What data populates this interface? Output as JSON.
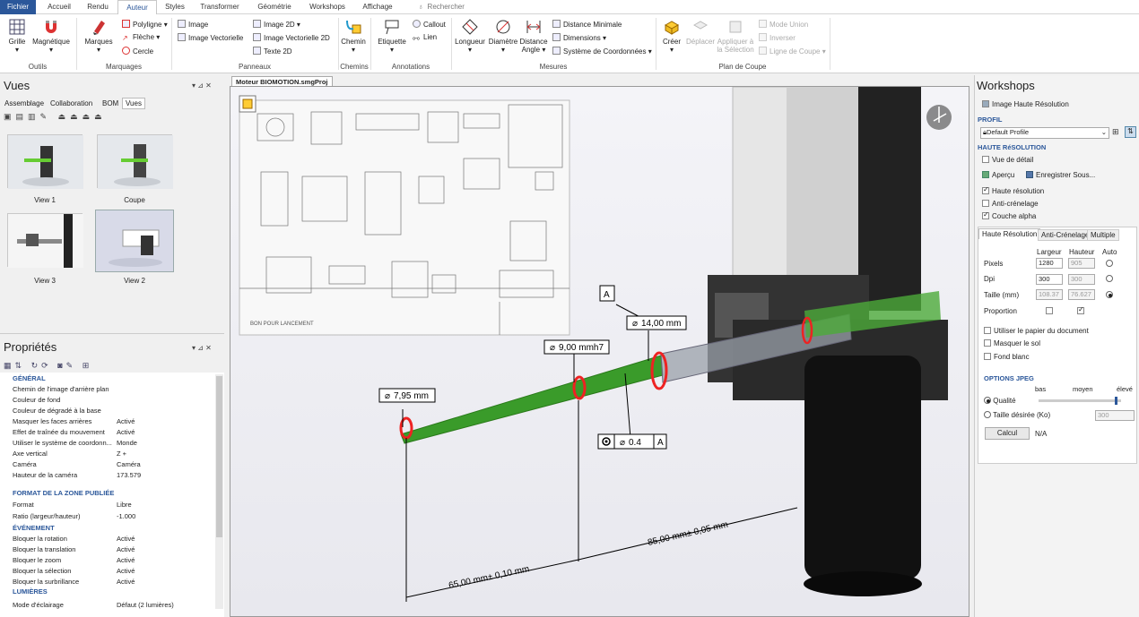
{
  "menu": {
    "file": "Fichier",
    "tabs": [
      "Accueil",
      "Rendu",
      "Auteur",
      "Styles",
      "Transformer",
      "Géométrie",
      "Workshops",
      "Affichage"
    ],
    "search": "Rechercher"
  },
  "ribbon": {
    "outils": {
      "label": "Outils",
      "grille": "Grille",
      "magnetique": "Magnétique"
    },
    "marquages": {
      "label": "Marquages",
      "marques": "Marques",
      "polyligne": "Polyligne",
      "fleche": "Flèche",
      "cercle": "Cercle"
    },
    "panneaux": {
      "label": "Panneaux",
      "image": "Image",
      "image_vect": "Image Vectorielle",
      "image2d": "Image 2D",
      "image_vect2d": "Image Vectorielle 2D",
      "texte2d": "Texte 2D"
    },
    "chemins": {
      "label": "Chemins",
      "chemin": "Chemin"
    },
    "annotations": {
      "label": "Annotations",
      "etiquette": "Etiquette",
      "callout": "Callout",
      "lien": "Lien"
    },
    "mesures": {
      "label": "Mesures",
      "longueur": "Longueur",
      "diametre": "Diamètre",
      "distance": "Distance",
      "angle": "Angle",
      "distance_min": "Distance Minimale",
      "dimensions": "Dimensions",
      "systeme": "Système de Coordonnées"
    },
    "coupe": {
      "label": "Plan de Coupe",
      "creer": "Créer",
      "deplacer": "Déplacer",
      "appliquer": "Appliquer à la Sélection",
      "mode_union": "Mode Union",
      "inverser": "Inverser",
      "ligne": "Ligne de Coupe"
    }
  },
  "vues": {
    "title": "Vues",
    "tabs": [
      "Assemblage",
      "Collaboration",
      "BOM",
      "Vues"
    ],
    "items": [
      "View 1",
      "Coupe",
      "View 3",
      "View 2"
    ]
  },
  "proprietes": {
    "title": "Propriétés",
    "sections": {
      "general": "GÉNÉRAL",
      "format": "FORMAT DE LA ZONE PUBLIÉE",
      "evenement": "ÉVÉNEMENT",
      "lumieres": "LUMIÈRES"
    },
    "rows": [
      {
        "k": "Chemin de l'image d'arrière plan",
        "v": ""
      },
      {
        "k": "Couleur de fond",
        "v": ""
      },
      {
        "k": "Couleur de dégradé à la base",
        "v": ""
      },
      {
        "k": "Masquer les faces arrières",
        "v": "Activé"
      },
      {
        "k": "Effet de traînée du mouvement",
        "v": "Activé"
      },
      {
        "k": "Utiliser le système de coordonn...",
        "v": "Monde"
      },
      {
        "k": "Axe vertical",
        "v": "Z +"
      },
      {
        "k": "Caméra",
        "v": "Caméra"
      },
      {
        "k": "Hauteur de la caméra",
        "v": "173.579"
      }
    ],
    "format_rows": [
      {
        "k": "Format",
        "v": "Libre"
      },
      {
        "k": "Ratio (largeur/hauteur)",
        "v": "-1.000"
      }
    ],
    "event_rows": [
      {
        "k": "Bloquer la rotation",
        "v": "Activé"
      },
      {
        "k": "Bloquer la translation",
        "v": "Activé"
      },
      {
        "k": "Bloquer le zoom",
        "v": "Activé"
      },
      {
        "k": "Bloquer la sélection",
        "v": "Activé"
      },
      {
        "k": "Bloquer la surbrillance",
        "v": "Activé"
      }
    ],
    "light_rows": [
      {
        "k": "Mode d'éclairage",
        "v": "Défaut (2 lumières)"
      }
    ]
  },
  "document": {
    "tab": "Moteur BIOMOTION.smgProj",
    "drawing_stamp": "BON POUR LANCEMENT",
    "annotations": {
      "d1": "7,95 mm",
      "d2": "9,00 mmh7",
      "d3": "14,00 mm",
      "label_a": "A",
      "tol_value": "0.4",
      "tol_ref": "A",
      "dim1": "65,00 mm± 0,10 mm",
      "dim2": "85,00 mm± 0,05 mm"
    }
  },
  "workshops": {
    "title": "Workshops",
    "subtitle": "Image Haute Résolution",
    "profil_hdr": "PROFIL",
    "profil": "Default Profile",
    "haute_hdr": "HAUTE RéSOLUTION",
    "vue_detail": "Vue de détail",
    "apercu": "Aperçu",
    "enregistrer": "Enregistrer Sous...",
    "haute_res": "Haute résolution",
    "anti": "Anti-crénelage",
    "alpha": "Couche alpha",
    "tabs": [
      "Haute Résolution",
      "Anti-Crénelage",
      "Multiple"
    ],
    "col_largeur": "Largeur",
    "col_hauteur": "Hauteur",
    "col_auto": "Auto",
    "pixels": "Pixels",
    "dpi": "Dpi",
    "taille": "Taille (mm)",
    "pixels_w": "1280",
    "pixels_h": "905",
    "dpi_w": "300",
    "dpi_h": "300",
    "taille_w": "108.37",
    "taille_h": "76.627",
    "proportion": "Proportion",
    "papier": "Utiliser le papier du document",
    "masquer_sol": "Masquer le sol",
    "fond_blanc": "Fond blanc",
    "jpeg_hdr": "OPTIONS JPEG",
    "bas": "bas",
    "moyen": "moyen",
    "eleve": "élevé",
    "qualite": "Qualité",
    "taille_desiree": "Taille désirée (Ko)",
    "taille_desiree_val": "300",
    "calcul": "Calcul",
    "na": "N/A",
    "quality_level": 0.95
  }
}
